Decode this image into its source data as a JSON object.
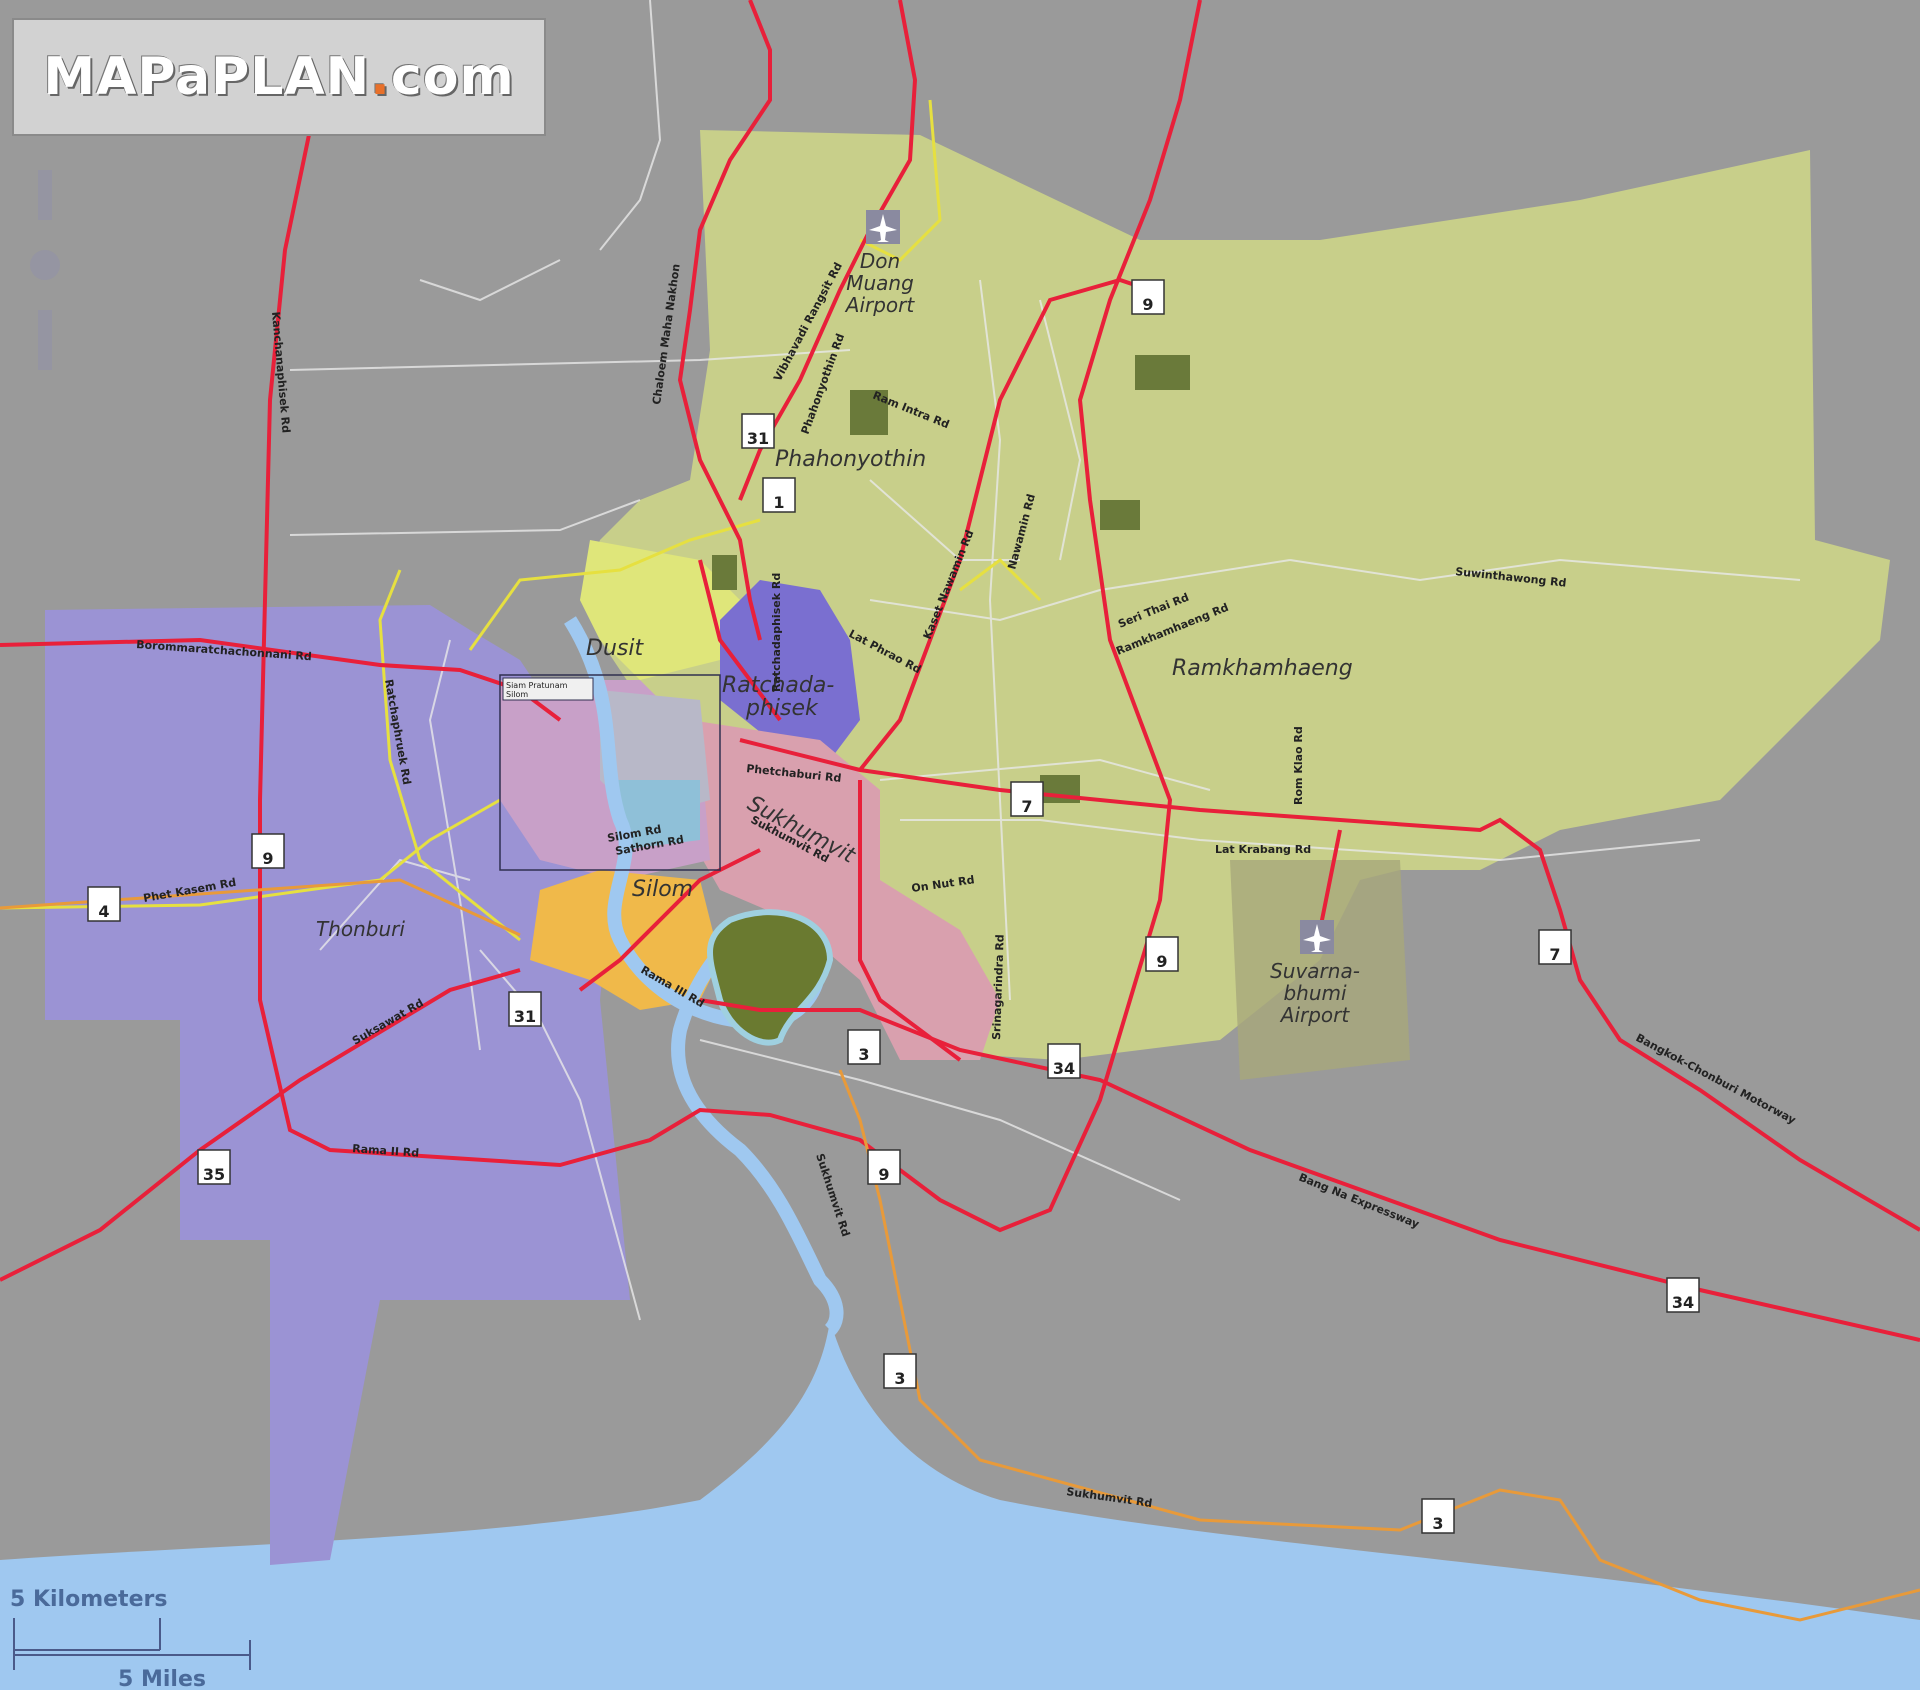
{
  "logo": {
    "brand": "MAPaPLAN",
    "dot": ".",
    "tld": "com"
  },
  "districts": {
    "dusit": "Dusit",
    "ratchadaphisek_1": "Ratchada-",
    "ratchadaphisek_2": "phisek",
    "phahonyothin": "Phahonyothin",
    "ramkhamhaeng": "Ramkhamhaeng",
    "sukhumvit": "Sukhumvit",
    "silom": "Silom",
    "thonburi": "Thonburi",
    "siam": "Siam Pratunam"
  },
  "airports": {
    "don_muang_1": "Don",
    "don_muang_2": "Muang",
    "don_muang_3": "Airport",
    "suvarnabhumi_1": "Suvarna-",
    "suvarnabhumi_2": "bhumi",
    "suvarnabhumi_3": "Airport"
  },
  "roads": {
    "phahonyothin_rd": "Phahonyothin Rd",
    "ram_intra_rd": "Ram Intra Rd",
    "vibhavadi_rd": "Vibhavadi Rangsit Rd",
    "ratchadaphisek_rd": "Ratchadaphisek Rd",
    "lat_phrao_rd": "Lat Phrao Rd",
    "nawamin_rd": "Nawamin Rd",
    "kaset_nawamin_rd": "Kaset Nawamin Rd",
    "seri_thai_rd": "Seri Thai Rd",
    "ramkhamhaeng_rd": "Ramkhamhaeng Rd",
    "suwinthawong_rd": "Suwinthawong Rd",
    "ram_klao_rd": "Rom Klao Rd",
    "lat_krabang_rd": "Lat Krabang Rd",
    "phetchaburi_rd": "Phetchaburi Rd",
    "sukhumvit_rd": "Sukhumvit Rd",
    "sukhumvit_rd_2": "Sukhumvit Rd",
    "sukhumvit_rd_3": "Sukhumvit Rd",
    "silom_rd": "Silom Rd",
    "sathorn_rd": "Sathorn Rd",
    "rama_iii_rd": "Rama III Rd",
    "on_nut_rd": "On Nut Rd",
    "srinagarindra_rd": "Srinagarindra Rd",
    "phet_kasem_rd": "Phet Kasem Rd",
    "suksawat_rd": "Suksawat Rd",
    "rama_ii_rd": "Rama II Rd",
    "ratchaphruek_rd": "Ratchaphruek Rd",
    "borommaratchachonnani_rd": "Borommaratchachonnani Rd",
    "kanchanaphisek_rd": "Kanchanaphisek Rd",
    "bang_na_expressway": "Bang Na Expressway",
    "motorway_7": "Bangkok-Chonburi Motorway",
    "chaloem_rd": "Chaloem Maha Nakhon"
  },
  "shields": [
    "9",
    "31",
    "1",
    "7",
    "9",
    "4",
    "9",
    "31",
    "3",
    "34",
    "9",
    "35",
    "34",
    "3",
    "3",
    "7"
  ],
  "inset_label_1": "Siam Pratunam",
  "inset_label_2": "Silom",
  "scale": {
    "km": "5 Kilometers",
    "mi": "5 Miles"
  },
  "colors": {
    "land": "#9a9a9a",
    "water": "#9fc8f0",
    "yellow_green": "#c8cf8a",
    "purple": "#9b93d4",
    "road_red": "#e8203a",
    "orange": "#f0b94a"
  }
}
